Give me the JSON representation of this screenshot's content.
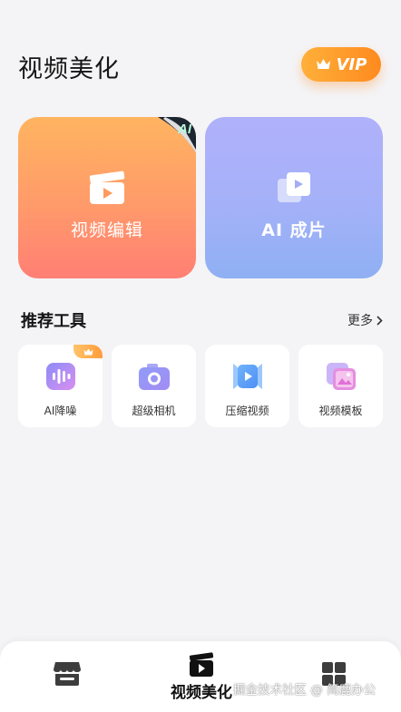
{
  "header": {
    "title": "视频美化",
    "vip_label": "VIP"
  },
  "cards": [
    {
      "label": "视频编辑",
      "icon": "clapperboard-icon",
      "badge": "AI"
    },
    {
      "label": "AI 成片",
      "icon": "stacked-video-icon"
    }
  ],
  "tools_section": {
    "title": "推荐工具",
    "more_label": "更多"
  },
  "tools": [
    {
      "label": "AI降噪",
      "icon": "sound-wave-icon",
      "vip": true
    },
    {
      "label": "超级相机",
      "icon": "camera-icon"
    },
    {
      "label": "压缩视频",
      "icon": "compress-video-icon"
    },
    {
      "label": "视频模板",
      "icon": "template-icon"
    }
  ],
  "tabbar": {
    "items": [
      {
        "icon": "store-icon"
      },
      {
        "icon": "clapperboard-icon",
        "label": "视频美化",
        "active": true
      },
      {
        "icon": "grid-icon"
      }
    ]
  },
  "watermark": "掘金技术社区 @ 简鹿办公",
  "colors": {
    "accent_orange": "#ff8a1e",
    "card_edit": "#ff9a6a",
    "card_ai": "#a4b1f8",
    "background": "#f4f4f6"
  }
}
